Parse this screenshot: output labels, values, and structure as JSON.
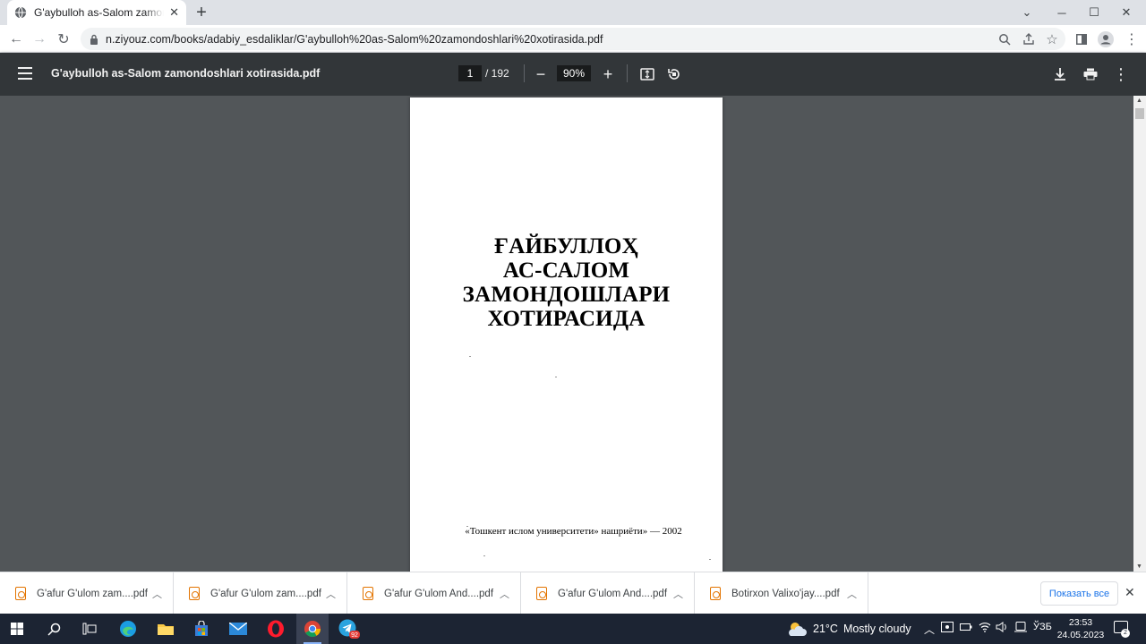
{
  "browser": {
    "tab_title": "G'aybulloh as-Salom zamondoshlari xotirasida.pdf",
    "new_tab_symbol": "+",
    "url": "n.ziyouz.com/books/adabiy_esdaliklar/G'aybulloh%20as-Salom%20zamondoshlari%20xotirasida.pdf"
  },
  "pdf_toolbar": {
    "title": "G'aybulloh as-Salom zamondoshlari xotirasida.pdf",
    "current_page": "1",
    "total_pages": "/ 192",
    "zoom": "90%"
  },
  "document": {
    "title_lines": [
      "ҒАЙБУЛЛОҲ",
      "АС-САЛОМ",
      "ЗАМОНДОШЛАРИ",
      "ХОТИРАСИДА"
    ],
    "publisher": "«Тошкент  ислом университети» нашриёти» — 2002"
  },
  "downloads": {
    "items": [
      "G'afur G'ulom zam....pdf",
      "G'afur G'ulom zam....pdf",
      "G'afur G'ulom And....pdf",
      "G'afur G'ulom And....pdf",
      "Botirxon Valixo'jay....pdf"
    ],
    "show_all_label": "Показать все"
  },
  "taskbar": {
    "weather_temp": "21°C",
    "weather_condition": "Mostly cloudy",
    "language": "ЎЗБ",
    "time": "23:53",
    "date": "24.05.2023",
    "telegram_badge": "92",
    "notification_count": "2"
  },
  "colors": {
    "pdf_toolbar_bg": "#323639",
    "viewer_bg": "#525659",
    "taskbar_bg": "#1c2433",
    "link_blue": "#1a73e8"
  }
}
